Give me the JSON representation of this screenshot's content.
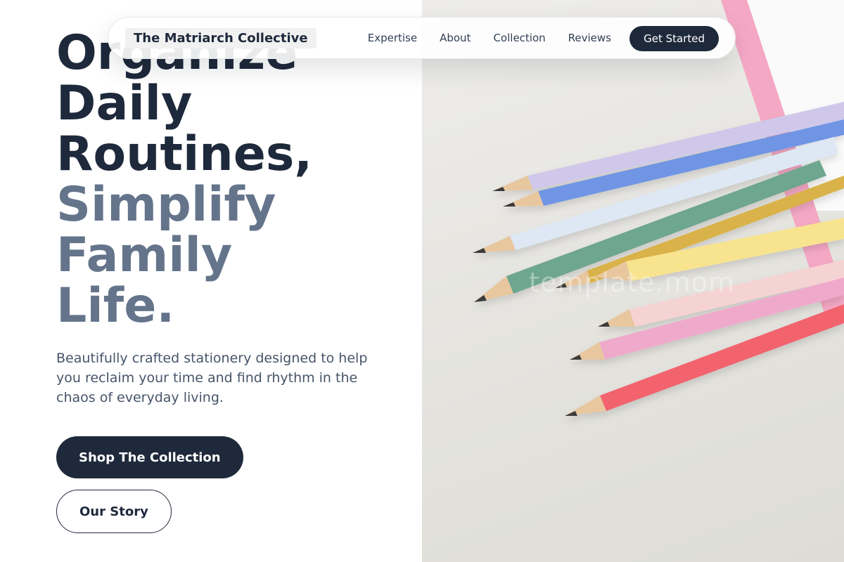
{
  "nav": {
    "brand": "The Matriarch Collective",
    "links": [
      "Expertise",
      "About",
      "Collection",
      "Reviews"
    ],
    "cta_label": "Get Started"
  },
  "hero": {
    "headline_dark": [
      "Organize",
      "Daily",
      "Routines,"
    ],
    "headline_muted": [
      "Simplify",
      "Family",
      "Life."
    ],
    "subtitle": "Beautifully crafted stationery designed to help you reclaim your time and find rhythm in the chaos of everyday living.",
    "primary_button": "Shop The Collection",
    "secondary_button": "Our Story"
  },
  "image": {
    "watermark": "template.mom"
  },
  "colors": {
    "primary": "#1e293b",
    "muted_heading": "#64748b",
    "body_text": "#475569"
  }
}
